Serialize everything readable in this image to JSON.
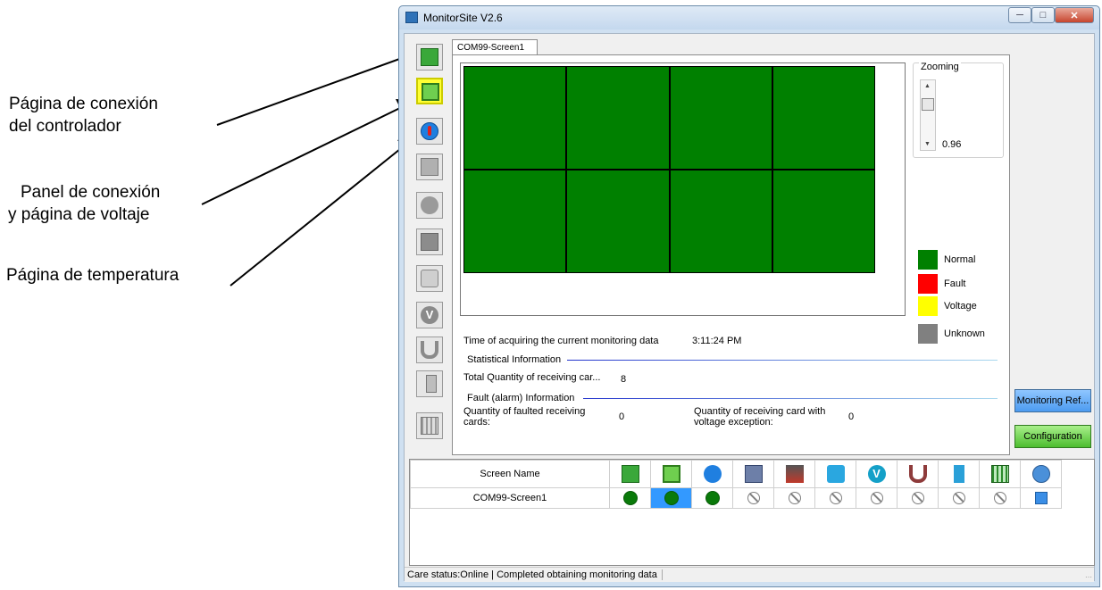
{
  "annotations": {
    "controller_page": [
      "Página de conexión",
      "del controlador"
    ],
    "panel_page": [
      "Panel de conexión",
      "y página de voltaje"
    ],
    "temperature_page": "Página de temperatura"
  },
  "window": {
    "title": "MonitorSite V2.6",
    "controls": [
      "minimize-icon",
      "maximize-icon",
      "close-icon"
    ]
  },
  "toolbar": {
    "buttons": [
      {
        "icon": "controller-board-icon",
        "active": false
      },
      {
        "icon": "panel-connection-icon",
        "active": true
      },
      {
        "icon": "temperature-icon",
        "active": false
      },
      {
        "icon": "receiving-card-icon",
        "active": false
      },
      {
        "icon": "humidity-icon",
        "active": false
      },
      {
        "icon": "smoke-icon",
        "active": false
      },
      {
        "icon": "fan-icon",
        "active": false
      },
      {
        "icon": "voltage-icon",
        "active": false
      },
      {
        "icon": "magnet-icon",
        "active": false
      },
      {
        "icon": "door-icon",
        "active": false
      },
      {
        "icon": "module-grid-icon",
        "active": false
      }
    ]
  },
  "tab": {
    "label": "COM99-Screen1"
  },
  "screen": {
    "rows": 2,
    "cols": 4,
    "cell_color": "#008000"
  },
  "zoom": {
    "label": "Zooming",
    "value": "0.96"
  },
  "legend": [
    {
      "label": "Normal",
      "color": "#008000"
    },
    {
      "label": "Fault",
      "color": "#ff0000"
    },
    {
      "label": "Voltage",
      "color": "#ffff00"
    },
    {
      "label": "Unknown",
      "color": "#808080"
    }
  ],
  "info": {
    "time_label": "Time of acquiring the current monitoring data",
    "time_value": "3:11:24 PM",
    "statistical_header": "Statistical Information",
    "total_label": "Total Quantity of receiving car...",
    "total_value": "8",
    "fault_header": "Fault (alarm) Information",
    "faulted_label_1": "Quantity of faulted receiving",
    "faulted_label_2": "cards:",
    "faulted_value": "0",
    "voltage_label_1": "Quantity of receiving card with",
    "voltage_label_2": "voltage exception:",
    "voltage_value": "0"
  },
  "buttons": {
    "monitoring_refresh": "Monitoring Ref...",
    "configuration": "Configuration"
  },
  "grid": {
    "name_header": "Screen Name",
    "columns": [
      "controller-board-icon",
      "panel-connection-icon",
      "temperature-icon",
      "receiving-card-icon",
      "smoke-icon",
      "fan-icon",
      "voltage-icon",
      "magnet-icon",
      "door-icon",
      "module-grid-icon",
      "network-icon"
    ],
    "rows": [
      {
        "name": "COM99-Screen1",
        "status": [
          "ok",
          "ok-selected",
          "ok",
          "na",
          "na",
          "na",
          "na",
          "na",
          "na",
          "na",
          "net"
        ]
      }
    ]
  },
  "statusbar": {
    "text": "Care status:Online  |  Completed obtaining monitoring data"
  }
}
